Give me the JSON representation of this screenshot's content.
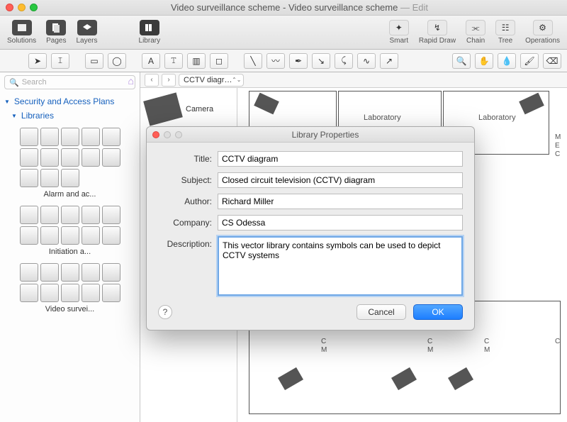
{
  "window": {
    "doc_title": "Video surveillance scheme - Video surveillance scheme",
    "status": "Edit"
  },
  "main_toolbar": {
    "left": [
      {
        "id": "solutions",
        "label": "Solutions"
      },
      {
        "id": "pages",
        "label": "Pages"
      },
      {
        "id": "layers",
        "label": "Layers"
      },
      {
        "id": "library",
        "label": "Library"
      }
    ],
    "right": [
      {
        "id": "smart",
        "label": "Smart"
      },
      {
        "id": "rapid",
        "label": "Rapid Draw"
      },
      {
        "id": "chain",
        "label": "Chain"
      },
      {
        "id": "tree",
        "label": "Tree"
      },
      {
        "id": "ops",
        "label": "Operations"
      }
    ]
  },
  "sidebar": {
    "search_placeholder": "Search",
    "section": "Security and Access Plans",
    "subsection": "Libraries",
    "groups": [
      {
        "label": "Alarm and ac...",
        "cells": 13
      },
      {
        "label": "Initiation a...",
        "cells": 10
      },
      {
        "label": "Video survei...",
        "cells": 10
      }
    ]
  },
  "nav": {
    "selected": "CCTV diagr…"
  },
  "palette": {
    "item0": "Camera"
  },
  "canvas": {
    "rooms": [
      {
        "label": "Laboratory"
      },
      {
        "label": "Laboratory"
      }
    ],
    "tags": [
      "M",
      "E",
      "C",
      "C",
      "M",
      "C",
      "M",
      "C",
      "M",
      "C"
    ]
  },
  "dialog": {
    "title": "Library Properties",
    "fields": {
      "title_label": "Title:",
      "title_value": "CCTV diagram",
      "subject_label": "Subject:",
      "subject_value": "Closed circuit television (CCTV) diagram",
      "author_label": "Author:",
      "author_value": "Richard Miller",
      "company_label": "Company:",
      "company_value": "CS Odessa",
      "desc_label": "Description:",
      "desc_value": "This vector library contains symbols can be used to depict CCTV systems"
    },
    "buttons": {
      "cancel": "Cancel",
      "ok": "OK",
      "help": "?"
    }
  }
}
